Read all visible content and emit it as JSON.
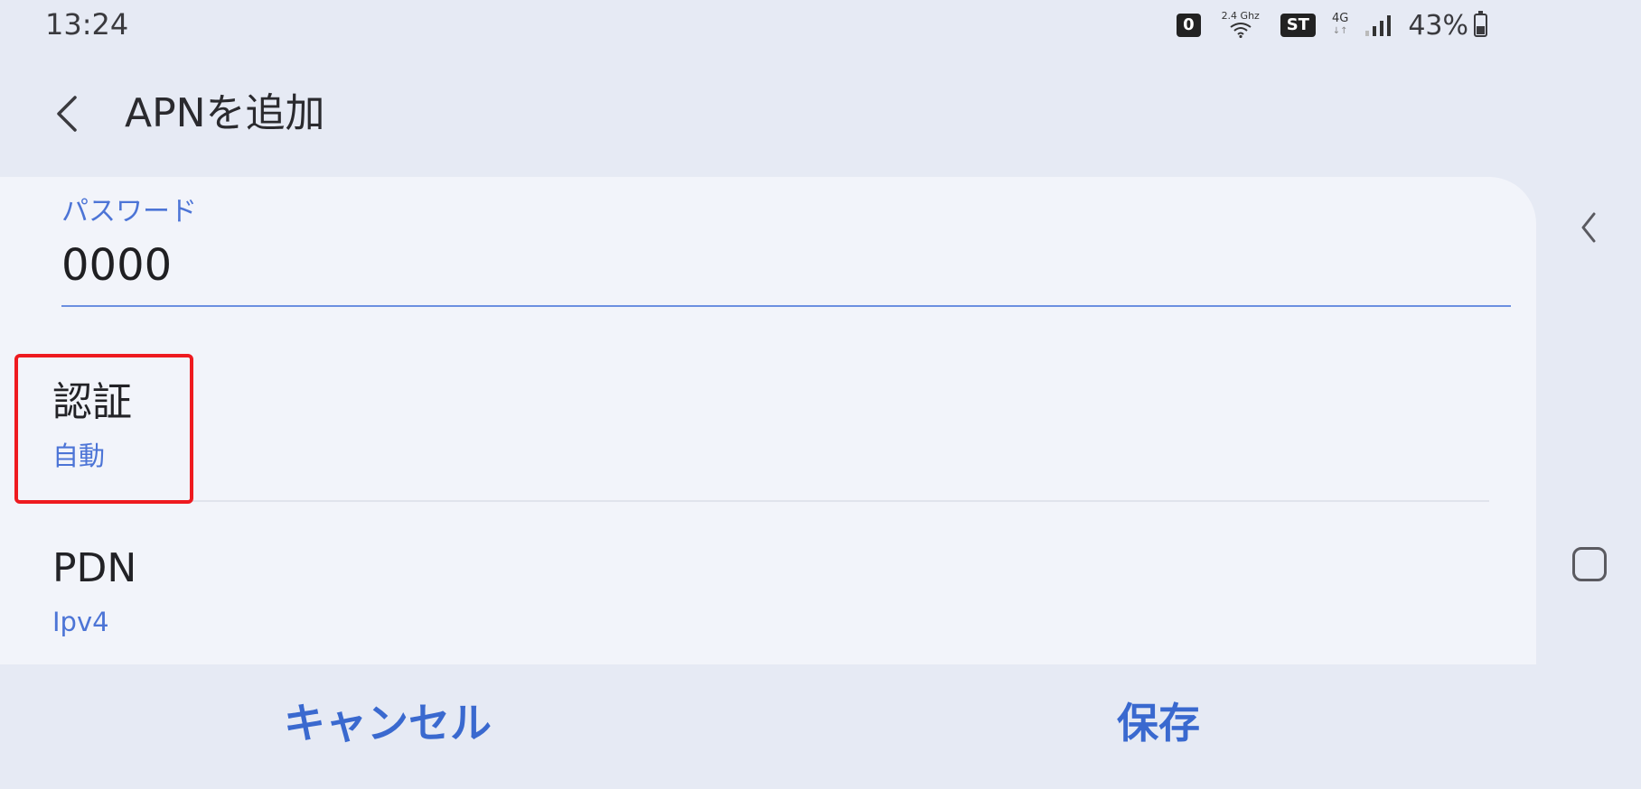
{
  "status_bar": {
    "time": "13:24",
    "notification_count": "0",
    "wifi_band": "2.4 Ghz",
    "st_badge": "ST",
    "network_type": "4G",
    "battery_percent": "43%",
    "battery_level": 0.43
  },
  "app_bar": {
    "title": "APNを追加"
  },
  "password_field": {
    "label": "パスワード",
    "value": "0000"
  },
  "settings": {
    "auth": {
      "title": "認証",
      "value": "自動"
    },
    "pdn": {
      "title": "PDN",
      "value": "Ipv4"
    }
  },
  "actions": {
    "cancel_label": "キャンセル",
    "save_label": "保存"
  },
  "colors": {
    "accent": "#4c74d6",
    "action": "#3a69cf",
    "highlight": "#ee1a1f",
    "background": "#e6eaf4",
    "card": "#f2f4fa"
  }
}
